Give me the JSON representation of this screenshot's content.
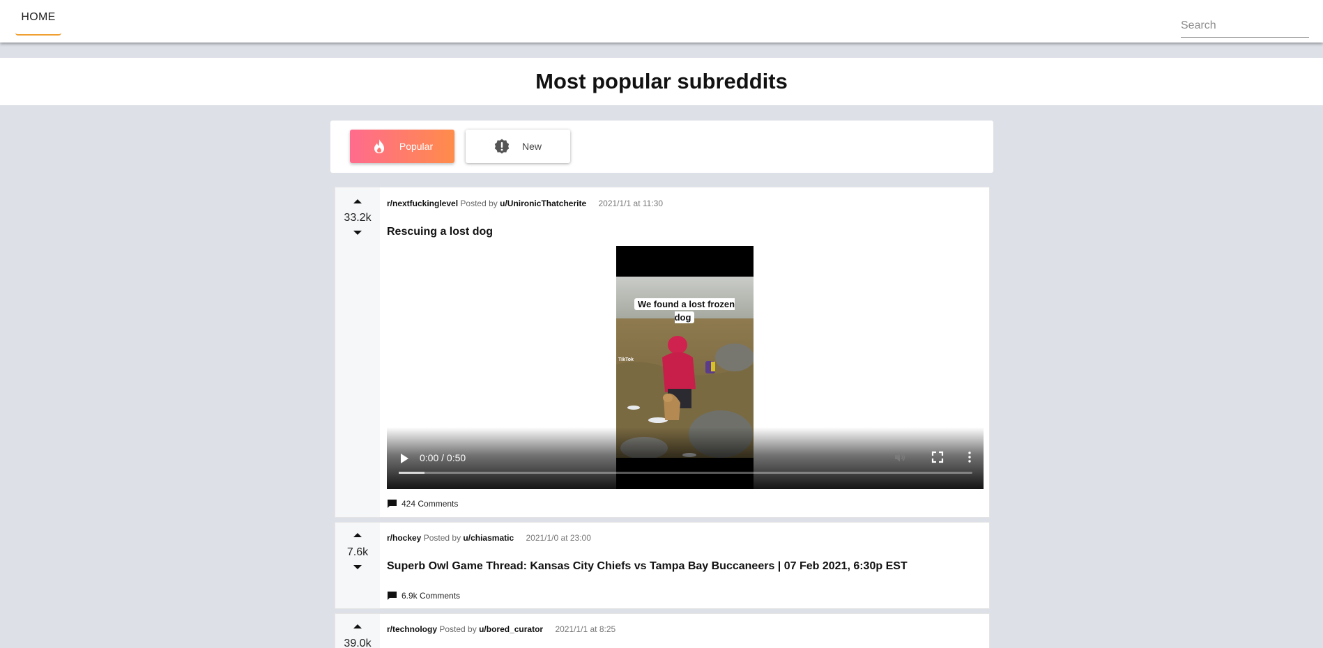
{
  "nav": {
    "home_label": "HOME",
    "search_placeholder": "Search"
  },
  "hero": {
    "title": "Most popular subreddits"
  },
  "filters": {
    "popular_label": "Popular",
    "new_label": "New",
    "active": "Popular"
  },
  "colors": {
    "background": "#dde1e7",
    "accent": "#f0a030",
    "popular_gradient_start": "#ff6b8d",
    "popular_gradient_end": "#ff8c4a"
  },
  "posts": [
    {
      "score": "33.2k",
      "subreddit": "r/nextfuckinglevel",
      "posted_by_prefix": "Posted by",
      "author": "u/UnironicThatcherite",
      "time": "2021/1/1 at 11:30",
      "title": "Rescuing a lost dog",
      "comments": "424 Comments",
      "video": {
        "caption": "We found a lost frozen dog",
        "time_display": "0:00 / 0:50",
        "watermark": "TikTok"
      }
    },
    {
      "score": "7.6k",
      "subreddit": "r/hockey",
      "posted_by_prefix": "Posted by",
      "author": "u/chiasmatic",
      "time": "2021/1/0 at 23:00",
      "title": "Superb Owl Game Thread: Kansas City Chiefs vs Tampa Bay Buccaneers | 07 Feb 2021, 6:30p EST",
      "comments": "6.9k Comments"
    },
    {
      "score": "39.0k",
      "subreddit": "r/technology",
      "posted_by_prefix": "Posted by",
      "author": "u/bored_curator",
      "time": "2021/1/1 at 8:25"
    }
  ]
}
